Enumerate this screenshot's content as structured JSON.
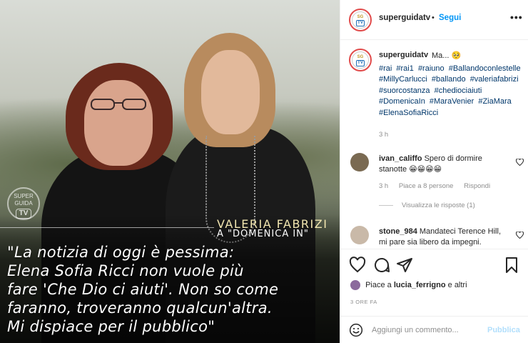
{
  "photo": {
    "watermark_top": "SUPER GUIDA",
    "watermark_tv": "TV",
    "name": "VALERIA FABRIZI",
    "subtitle": "A \"DOMENICA IN\"",
    "quote_lines": [
      "\"La notizia di oggi è pessima:",
      "Elena Sofia Ricci non vuole più",
      "fare 'Che Dio ci aiuti'. Non so come",
      "faranno, troveranno qualcun'altra.",
      "Mi dispiace per il pubblico\""
    ]
  },
  "header": {
    "username": "superguidatv",
    "separator": "•",
    "follow_label": "Segui",
    "more_label": "•••"
  },
  "caption": {
    "username": "superguidatv",
    "text": "Ma... 🥺",
    "hashtags": [
      "#rai",
      "#rai1",
      "#raiuno",
      "#Ballandoconlestelle",
      "#MillyCarlucci",
      "#ballando",
      "#valeriafabrizi",
      "#suorcostanza",
      "#chediociaiuti",
      "#DomenicaIn",
      "#MaraVenier",
      "#ZiaMara",
      "#ElenaSofiaRicci"
    ],
    "time": "3 h"
  },
  "comments": [
    {
      "username": "ivan_califfo",
      "text": "Spero di dormire stanotte 😁😁😁😁",
      "time": "3 h",
      "likes": "Piace a 8 persone",
      "reply_label": "Rispondi",
      "view_replies": "Visualizza le risposte (1)"
    },
    {
      "username": "stone_984",
      "text": "Mandateci Terence Hill, mi pare sia libero da impegni."
    }
  ],
  "likes": {
    "prefix": "Piace a",
    "user": "lucia_ferrigno",
    "suffix": "e altri"
  },
  "post_time": "3 ORE FA",
  "add_comment": {
    "placeholder": "Aggiungi un commento...",
    "publish_label": "Pubblica"
  },
  "colors": {
    "link_blue": "#0095f6",
    "hashtag_blue": "#00376b",
    "publish_disabled": "#b2dffc",
    "muted": "#8e8e8e"
  }
}
